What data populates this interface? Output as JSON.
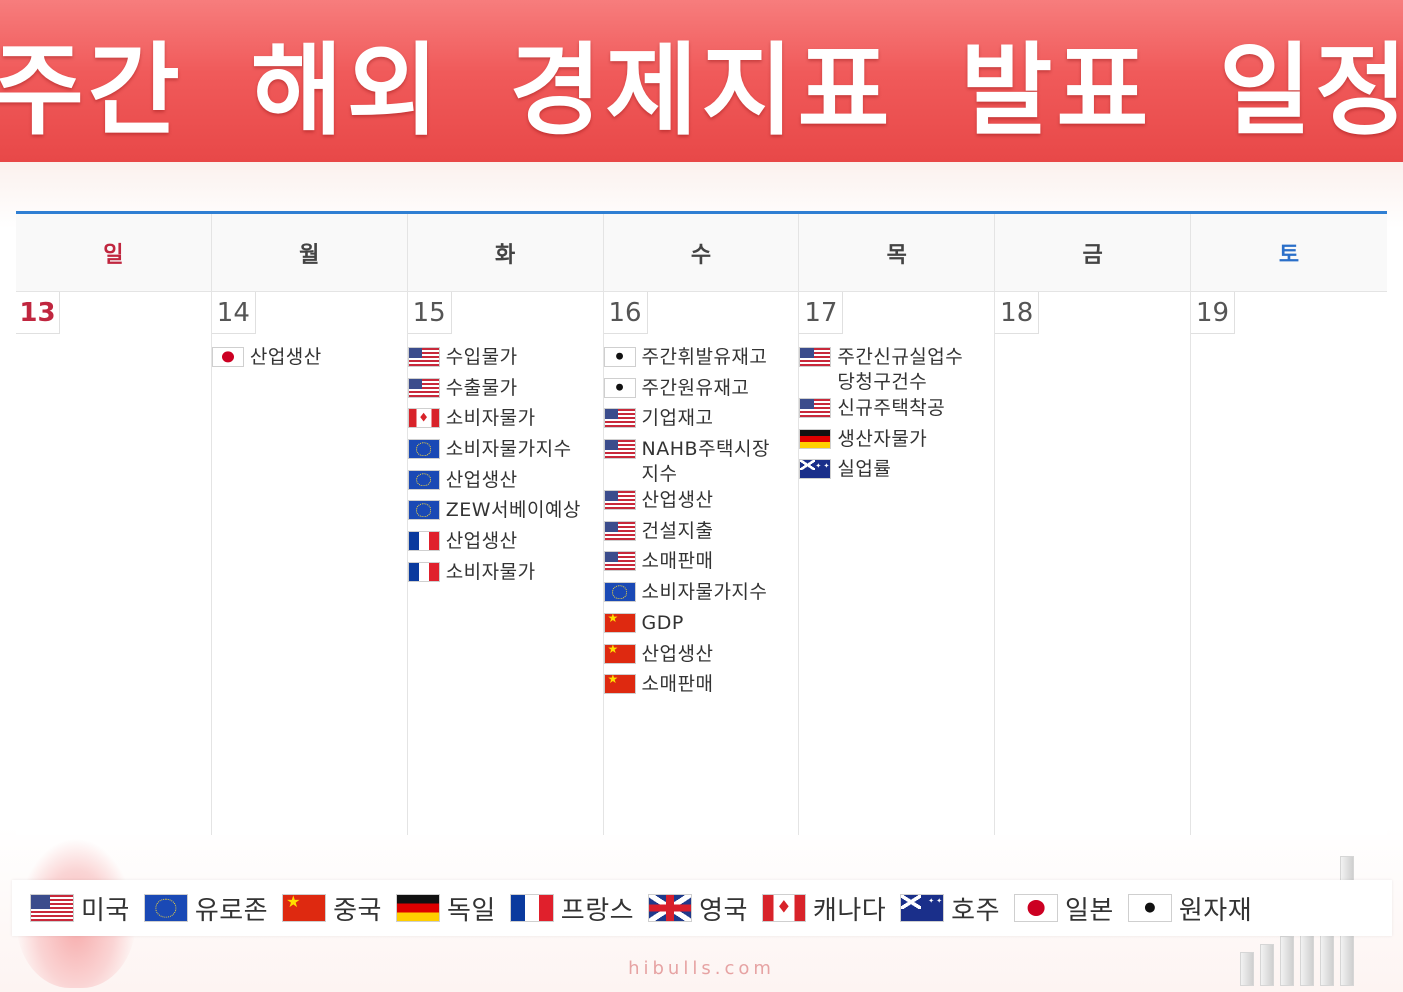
{
  "banner": {
    "title": "주간 해외 경제지표 발표 일정"
  },
  "calendar": {
    "weekdays": [
      {
        "label": "일",
        "kind": "sun"
      },
      {
        "label": "월",
        "kind": ""
      },
      {
        "label": "화",
        "kind": ""
      },
      {
        "label": "수",
        "kind": ""
      },
      {
        "label": "목",
        "kind": ""
      },
      {
        "label": "금",
        "kind": ""
      },
      {
        "label": "토",
        "kind": "sat"
      }
    ],
    "days": [
      {
        "date": "13",
        "events": []
      },
      {
        "date": "14",
        "events": [
          {
            "flag": "jp",
            "label": "산업생산"
          }
        ]
      },
      {
        "date": "15",
        "events": [
          {
            "flag": "us",
            "label": "수입물가"
          },
          {
            "flag": "us",
            "label": "수출물가"
          },
          {
            "flag": "ca",
            "label": "소비자물가"
          },
          {
            "flag": "eu",
            "label": "소비자물가지수"
          },
          {
            "flag": "eu",
            "label": "산업생산"
          },
          {
            "flag": "eu",
            "label": "ZEW서베이예상"
          },
          {
            "flag": "fr",
            "label": "산업생산"
          },
          {
            "flag": "fr",
            "label": "소비자물가"
          }
        ]
      },
      {
        "date": "16",
        "events": [
          {
            "flag": "cm",
            "label": "주간휘발유재고"
          },
          {
            "flag": "cm",
            "label": "주간원유재고"
          },
          {
            "flag": "us",
            "label": "기업재고"
          },
          {
            "flag": "us",
            "label": "NAHB주택시장\n지수"
          },
          {
            "flag": "us",
            "label": "산업생산"
          },
          {
            "flag": "us",
            "label": "건설지출"
          },
          {
            "flag": "us",
            "label": "소매판매"
          },
          {
            "flag": "eu",
            "label": "소비자물가지수"
          },
          {
            "flag": "cn",
            "label": "GDP"
          },
          {
            "flag": "cn",
            "label": "산업생산"
          },
          {
            "flag": "cn",
            "label": "소매판매"
          }
        ]
      },
      {
        "date": "17",
        "events": [
          {
            "flag": "us",
            "label": "주간신규실업수\n당청구건수"
          },
          {
            "flag": "us",
            "label": "신규주택착공"
          },
          {
            "flag": "de",
            "label": "생산자물가"
          },
          {
            "flag": "au",
            "label": "실업률"
          }
        ]
      },
      {
        "date": "18",
        "events": []
      },
      {
        "date": "19",
        "events": []
      }
    ]
  },
  "legend": [
    {
      "flag": "us",
      "label": "미국"
    },
    {
      "flag": "eu",
      "label": "유로존"
    },
    {
      "flag": "cn",
      "label": "중국"
    },
    {
      "flag": "de",
      "label": "독일"
    },
    {
      "flag": "fr",
      "label": "프랑스"
    },
    {
      "flag": "uk",
      "label": "영국"
    },
    {
      "flag": "ca",
      "label": "캐나다"
    },
    {
      "flag": "au",
      "label": "호주"
    },
    {
      "flag": "jp",
      "label": "일본"
    },
    {
      "flag": "cm",
      "label": "원자재"
    }
  ],
  "footer": {
    "text": "hibulls.com"
  },
  "colors": {
    "banner": "#f05a5a",
    "accent_line": "#2f7fd3",
    "sunday": "#c0263f",
    "saturday": "#2a6fc9"
  }
}
